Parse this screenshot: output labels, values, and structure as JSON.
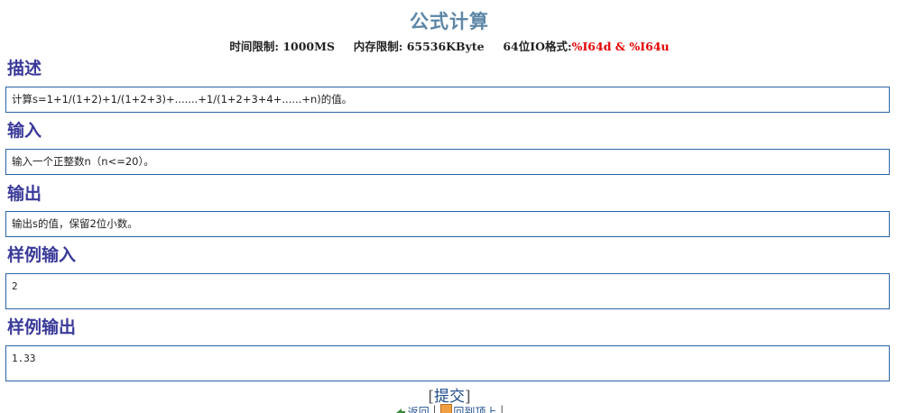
{
  "problem": {
    "title": "公式计算",
    "limits": {
      "time_label": "时间限制:",
      "time_value": "1000MS",
      "memory_label": "内存限制:",
      "memory_value": "65536KByte",
      "io_label": "64位IO格式:",
      "io_value": "%I64d & %I64u"
    }
  },
  "sections": {
    "description": {
      "heading": "描述",
      "content": "计算s=1+1/(1+2)+1/(1+2+3)+.......+1/(1+2+3+4+......+n)的值。"
    },
    "input": {
      "heading": "输入",
      "content": "输入一个正整数n（n<=20）。"
    },
    "output": {
      "heading": "输出",
      "content": "输出s的值，保留2位小数。"
    },
    "sample_input": {
      "heading": "样例输入",
      "content": "2"
    },
    "sample_output": {
      "heading": "样例输出",
      "content": "1.33"
    }
  },
  "actions": {
    "submit_open": "[",
    "submit_label": "提交",
    "submit_close": "]",
    "back_label": "返回",
    "separator": "|",
    "top_label": "回到顶上"
  },
  "colors": {
    "title": "#5d86a6",
    "heading": "#3a3a9a",
    "box_border": "#2b64a8",
    "io_value": "#e60000",
    "link": "#1f4e8c"
  }
}
